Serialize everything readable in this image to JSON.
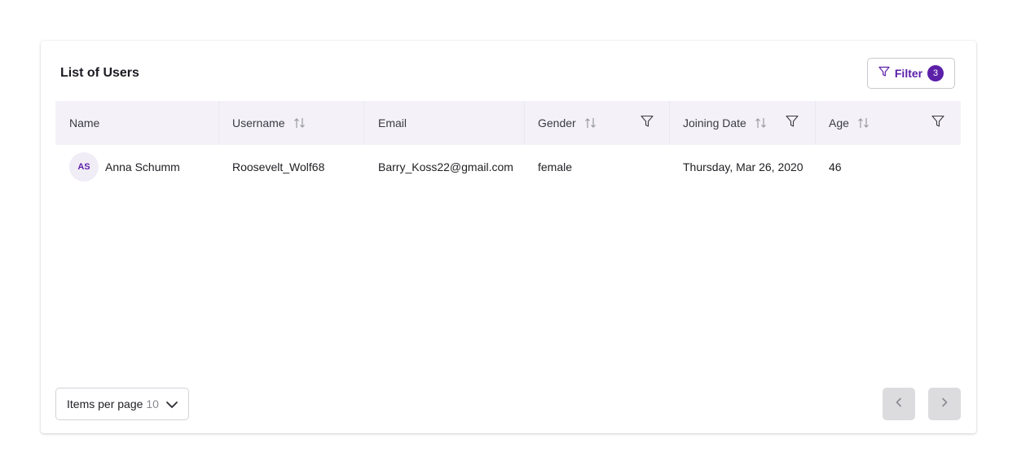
{
  "header": {
    "title": "List of Users"
  },
  "filter": {
    "label": "Filter",
    "count": "3"
  },
  "table": {
    "columns": {
      "name": "Name",
      "username": "Username",
      "email": "Email",
      "gender": "Gender",
      "joining_date": "Joining Date",
      "age": "Age"
    },
    "rows": [
      {
        "initials": "AS",
        "name": "Anna Schumm",
        "username": "Roosevelt_Wolf68",
        "email": "Barry_Koss22@gmail.com",
        "gender": "female",
        "joining_date": "Thursday, Mar 26, 2020",
        "age": "46"
      }
    ]
  },
  "pagination": {
    "items_per_page_label": "Items per page",
    "items_per_page_value": "10"
  },
  "colors": {
    "accent": "#5b1fa8",
    "header_bg": "#f4f2f8"
  },
  "icons": [
    "filter-icon",
    "sort-icon",
    "chevron-down-icon",
    "chevron-left-icon",
    "chevron-right-icon"
  ]
}
